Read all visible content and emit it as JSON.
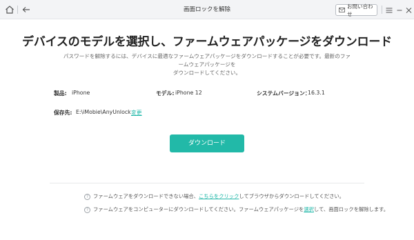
{
  "window": {
    "title": "画面ロックを解除",
    "contact_label": "お問い合わせ"
  },
  "main": {
    "headline": "デバイスのモデルを選択し、ファームウェアパッケージをダウンロード",
    "subtext_line1": "パスワードを解除するには、デバイスに最適なファームウェアパッケージをダウンロードすることが必要です。最新のファームウェアパッケージを",
    "subtext_line2": "ダウンロードしてください。",
    "info": {
      "product_label": "製品:",
      "product_value": "iPhone",
      "model_label": "モデル:",
      "model_value": "iPhone 12",
      "system_label": "システムバージョン：",
      "system_value": "16.3.1",
      "save_label": "保存先:",
      "save_value": "E:\\iMobie\\AnyUnlock",
      "change_link": "変更"
    },
    "download_button": "ダウンロード"
  },
  "help": {
    "line1_before": "ファームウェアをダウンロードできない場合、",
    "line1_link": "こちらをクリック",
    "line1_after": "してブラウザからダウンロードしてください。",
    "line2_before": "ファームウェアをコンピューターにダウンロードしてください。ファームウェアパッケージを",
    "line2_link": "選択",
    "line2_after": "して、画面ロックを解除します。",
    "icon_glyph": "?"
  },
  "colors": {
    "accent": "#22b9a8",
    "link": "#1fb7a8",
    "titlebar_bg": "#f3f4f6"
  }
}
